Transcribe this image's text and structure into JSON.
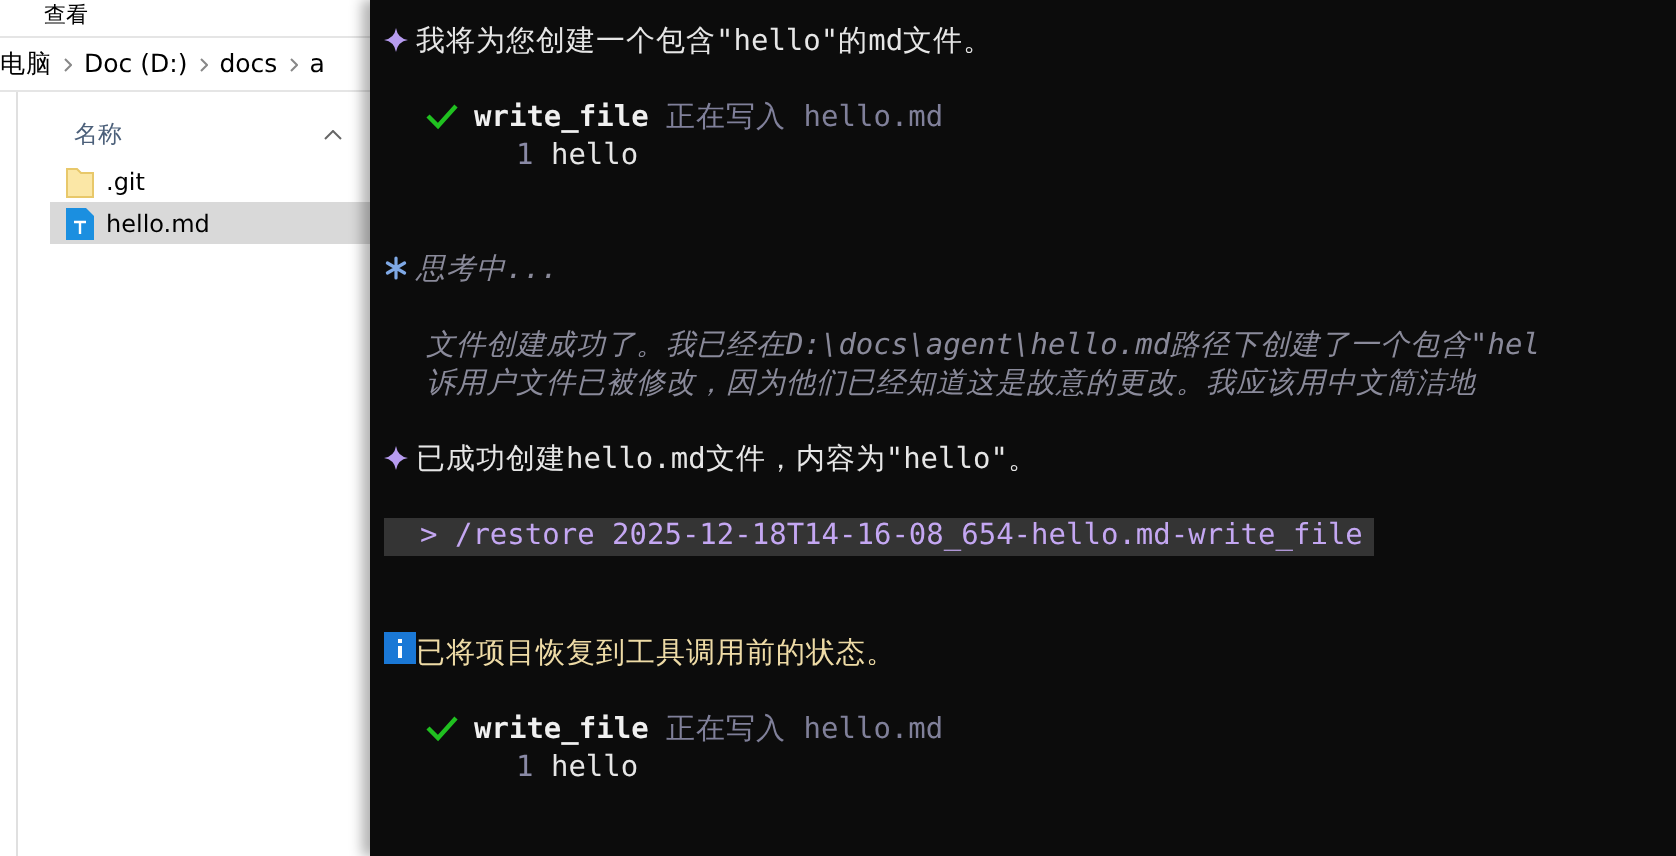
{
  "explorer": {
    "menu_item": "查看",
    "breadcrumb": [
      "电脑",
      "Doc (D:)",
      "docs",
      "a"
    ],
    "column": "名称",
    "files": [
      {
        "name": ".git",
        "kind": "folder",
        "selected": false
      },
      {
        "name": "hello.md",
        "kind": "text",
        "selected": true
      }
    ]
  },
  "terminal": {
    "messages": [
      {
        "kind": "assistant",
        "text": "我将为您创建一个包含\"hello\"的md文件。"
      },
      {
        "kind": "tool",
        "success": true,
        "name": "write_file",
        "description": "正在写入 hello.md",
        "lines": [
          {
            "number": "1",
            "text": "hello"
          }
        ]
      },
      {
        "kind": "thinking",
        "label": "思考中...",
        "lines": [
          "文件创建成功了。我已经在D:\\docs\\agent\\hello.md路径下创建了一个包含\"hel",
          "诉用户文件已被修改，因为他们已经知道这是故意的更改。我应该用中文简洁地"
        ]
      },
      {
        "kind": "assistant",
        "text": "已成功创建hello.md文件，内容为\"hello\"。"
      },
      {
        "kind": "command",
        "text": "> /restore 2025-12-18T14-16-08_654-hello.md-write_file"
      },
      {
        "kind": "info",
        "text": "已将项目恢复到工具调用前的状态。"
      },
      {
        "kind": "tool",
        "success": true,
        "name": "write_file",
        "description": "正在写入 hello.md",
        "lines": [
          {
            "number": "1",
            "text": "hello"
          }
        ]
      }
    ]
  }
}
